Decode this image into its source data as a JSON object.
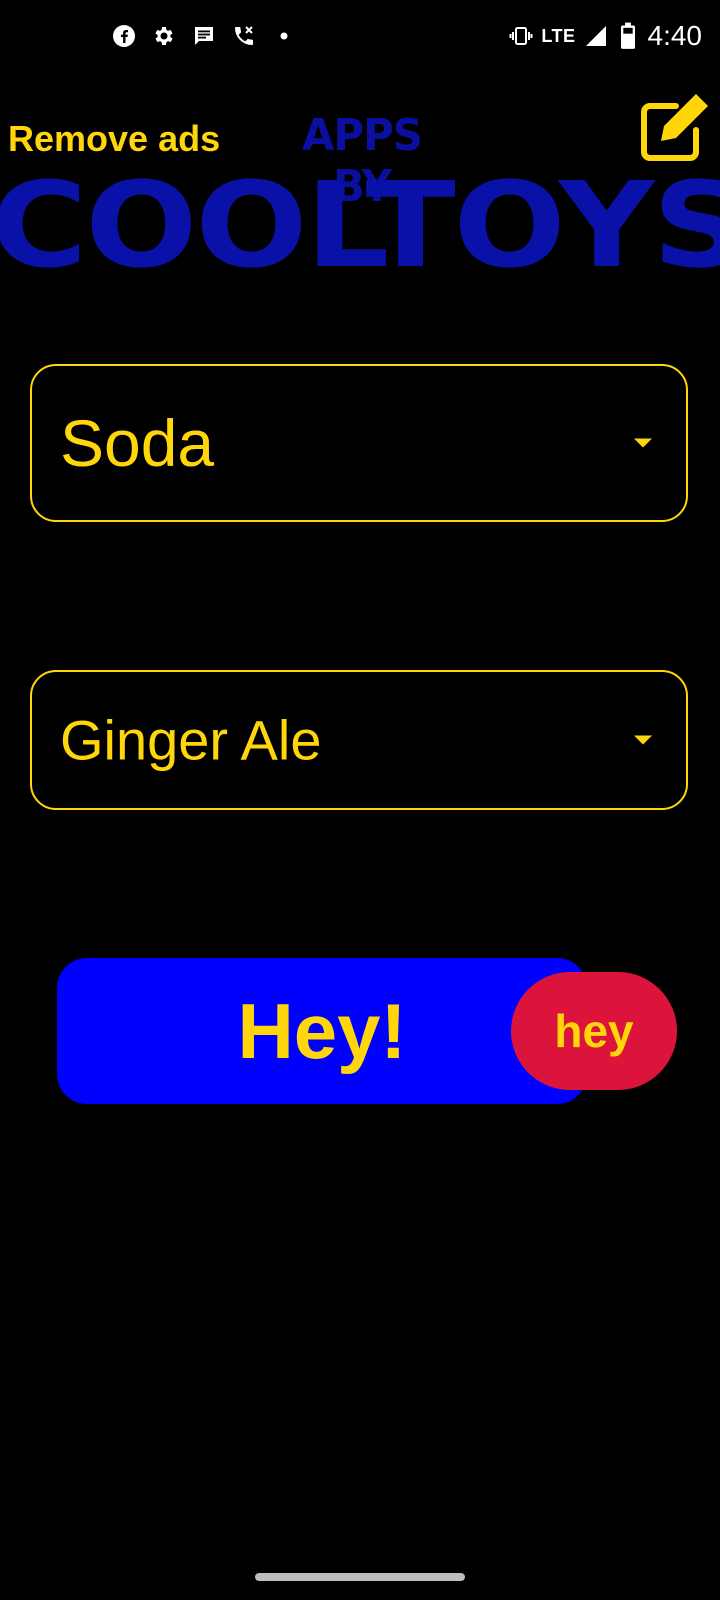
{
  "status_bar": {
    "time": "4:40",
    "network": "LTE",
    "left_icons": [
      "facebook-icon",
      "settings-icon",
      "message-icon",
      "missed-call-icon",
      "dot-icon"
    ],
    "right_icons": [
      "vibrate-icon",
      "signal-icon",
      "battery-icon"
    ]
  },
  "header": {
    "remove_ads_label": "Remove ads",
    "logo_apps_by": "APPS BY",
    "logo_brand": "COOLTOYS",
    "edit_icon": "edit-icon"
  },
  "dropdowns": [
    {
      "value": "Soda"
    },
    {
      "value": "Ginger Ale"
    }
  ],
  "buttons": {
    "main_label": "Hey!",
    "fab_label": "hey"
  },
  "colors": {
    "accent": "#FFD60A",
    "background": "#000000",
    "primary_button": "#0000FF",
    "fab": "#DC143C",
    "logo": "#0A11A8"
  }
}
